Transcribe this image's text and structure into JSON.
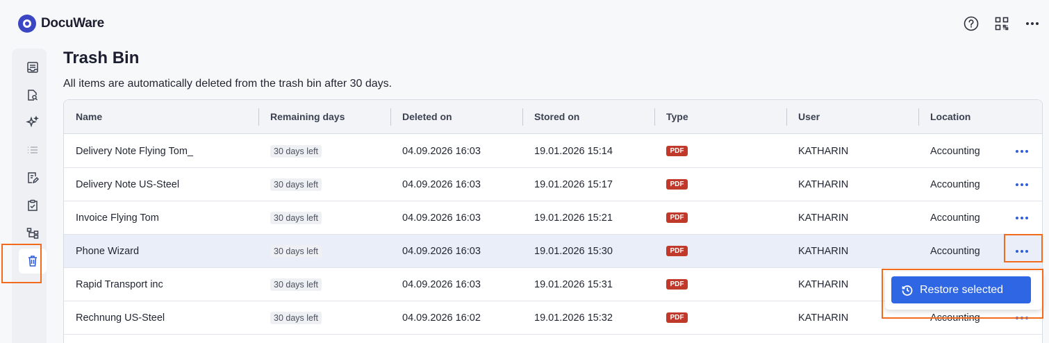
{
  "app": {
    "brand": "DocuWare"
  },
  "header": {
    "icons": [
      "help-icon",
      "qr-code-icon",
      "more-icon"
    ]
  },
  "sidebar": {
    "items": [
      {
        "name": "inbox",
        "icon": "tray-icon"
      },
      {
        "name": "search",
        "icon": "document-search-icon"
      },
      {
        "name": "ai",
        "icon": "sparkle-icon"
      },
      {
        "name": "list",
        "icon": "list-icon"
      },
      {
        "name": "tasks",
        "icon": "document-edit-icon"
      },
      {
        "name": "approvals",
        "icon": "clipboard-check-icon"
      },
      {
        "name": "workflow",
        "icon": "workflow-icon"
      },
      {
        "name": "trash",
        "icon": "trash-icon",
        "active": true
      }
    ]
  },
  "page": {
    "title": "Trash Bin",
    "subtitle": "All items are automatically deleted from the trash bin after 30 days."
  },
  "table": {
    "columns": [
      "Name",
      "Remaining days",
      "Deleted on",
      "Stored on",
      "Type",
      "User",
      "Location"
    ],
    "rows": [
      {
        "name": "Delivery Note Flying Tom_",
        "remaining": "30 days left",
        "deleted": "04.09.2026 16:03",
        "stored": "19.01.2026 15:14",
        "type": "PDF",
        "user": "KATHARIN",
        "location": "Accounting"
      },
      {
        "name": "Delivery Note US-Steel",
        "remaining": "30 days left",
        "deleted": "04.09.2026 16:03",
        "stored": "19.01.2026 15:17",
        "type": "PDF",
        "user": "KATHARIN",
        "location": "Accounting"
      },
      {
        "name": "Invoice Flying Tom",
        "remaining": "30 days left",
        "deleted": "04.09.2026 16:03",
        "stored": "19.01.2026 15:21",
        "type": "PDF",
        "user": "KATHARIN",
        "location": "Accounting"
      },
      {
        "name": "Phone Wizard",
        "remaining": "30 days left",
        "deleted": "04.09.2026 16:03",
        "stored": "19.01.2026 15:30",
        "type": "PDF",
        "user": "KATHARIN",
        "location": "Accounting",
        "selected": true
      },
      {
        "name": "Rapid Transport inc",
        "remaining": "30 days left",
        "deleted": "04.09.2026 16:03",
        "stored": "19.01.2026 15:31",
        "type": "PDF",
        "user": "KATHARIN",
        "location": ""
      },
      {
        "name": "Rechnung US-Steel",
        "remaining": "30 days left",
        "deleted": "04.09.2026 16:02",
        "stored": "19.01.2026 15:32",
        "type": "PDF",
        "user": "KATHARIN",
        "location": "Accounting"
      }
    ]
  },
  "popup": {
    "restore_label": "Restore selected",
    "icon": "restore-history-icon"
  },
  "colors": {
    "accent": "#2f66e3",
    "highlight": "#f26a1b",
    "pdf_badge": "#c0392b",
    "brand": "#3a46c4"
  }
}
